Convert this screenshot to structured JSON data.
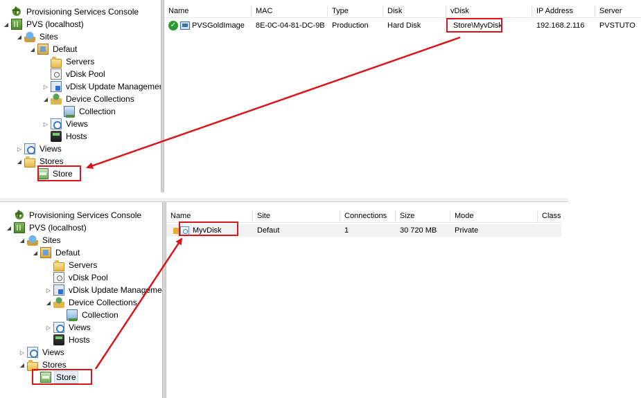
{
  "top": {
    "tree": [
      {
        "label": "Provisioning Services Console",
        "icon": "console-icon",
        "level": 0,
        "twisty": ""
      },
      {
        "label": "PVS (localhost)",
        "icon": "farm-icon",
        "level": 0,
        "twisty": "◢"
      },
      {
        "label": "Sites",
        "icon": "sites-icon",
        "level": 1,
        "twisty": "◢"
      },
      {
        "label": "Defaut",
        "icon": "site-icon",
        "level": 2,
        "twisty": "◢"
      },
      {
        "label": "Servers",
        "icon": "folder-icon",
        "level": 3,
        "twisty": ""
      },
      {
        "label": "vDisk Pool",
        "icon": "disk-icon",
        "level": 3,
        "twisty": ""
      },
      {
        "label": "vDisk Update Management",
        "icon": "update-icon",
        "level": 3,
        "twisty": "▷"
      },
      {
        "label": "Device Collections",
        "icon": "device-collections-icon",
        "level": 3,
        "twisty": "◢"
      },
      {
        "label": "Collection",
        "icon": "collection-icon",
        "level": 4,
        "twisty": ""
      },
      {
        "label": "Views",
        "icon": "views-icon",
        "level": 3,
        "twisty": "▷"
      },
      {
        "label": "Hosts",
        "icon": "hosts-icon",
        "level": 3,
        "twisty": ""
      },
      {
        "label": "Views",
        "icon": "views-icon",
        "level": 1,
        "twisty": "▷"
      },
      {
        "label": "Stores",
        "icon": "folder-icon",
        "level": 1,
        "twisty": "◢"
      },
      {
        "label": "Store",
        "icon": "store-icon",
        "level": 2,
        "twisty": ""
      }
    ],
    "columns": [
      "Name",
      "MAC",
      "Type",
      "Disk",
      "vDisk",
      "IP Address",
      "Server"
    ],
    "rows": [
      {
        "name": "PVSGoldImage",
        "mac": "8E-0C-04-81-DC-9B",
        "type": "Production",
        "disk": "Hard Disk",
        "vdisk": "Store\\MyvDisk",
        "ip": "192.168.2.116",
        "server": "PVSTUTO"
      }
    ]
  },
  "bottom": {
    "tree": [
      {
        "label": "Provisioning Services Console",
        "icon": "console-icon",
        "level": 0,
        "twisty": ""
      },
      {
        "label": "PVS (localhost)",
        "icon": "farm-icon",
        "level": 0,
        "twisty": "◢"
      },
      {
        "label": "Sites",
        "icon": "sites-icon",
        "level": 1,
        "twisty": "◢"
      },
      {
        "label": "Defaut",
        "icon": "site-icon",
        "level": 2,
        "twisty": "◢"
      },
      {
        "label": "Servers",
        "icon": "folder-icon",
        "level": 3,
        "twisty": ""
      },
      {
        "label": "vDisk Pool",
        "icon": "disk-icon",
        "level": 3,
        "twisty": ""
      },
      {
        "label": "vDisk Update Management",
        "icon": "update-icon",
        "level": 3,
        "twisty": "▷"
      },
      {
        "label": "Device Collections",
        "icon": "device-collections-icon",
        "level": 3,
        "twisty": "◢"
      },
      {
        "label": "Collection",
        "icon": "collection-icon",
        "level": 4,
        "twisty": ""
      },
      {
        "label": "Views",
        "icon": "views-icon",
        "level": 3,
        "twisty": "▷"
      },
      {
        "label": "Hosts",
        "icon": "hosts-icon",
        "level": 3,
        "twisty": ""
      },
      {
        "label": "Views",
        "icon": "views-icon",
        "level": 1,
        "twisty": "▷"
      },
      {
        "label": "Stores",
        "icon": "folder-icon",
        "level": 1,
        "twisty": "◢"
      },
      {
        "label": "Store",
        "icon": "store-icon",
        "level": 2,
        "twisty": ""
      }
    ],
    "columns": [
      "Name",
      "Site",
      "Connections",
      "Size",
      "Mode",
      "Class"
    ],
    "rows": [
      {
        "name": "MyvDisk",
        "site": "Defaut",
        "connections": "1",
        "size": "30 720 MB",
        "mode": "Private",
        "class": ""
      }
    ]
  },
  "colors": {
    "callout": "#d9141b",
    "arrow": "#d9141b",
    "splitter": "#c8c8c8"
  }
}
